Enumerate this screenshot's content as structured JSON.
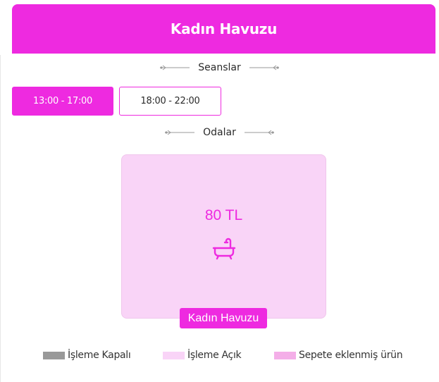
{
  "header": {
    "title": "Kadın Havuzu"
  },
  "sessions": {
    "heading": "Seanslar",
    "items": [
      {
        "label": "13:00 - 17:00",
        "active": true
      },
      {
        "label": "18:00 - 22:00",
        "active": false
      }
    ]
  },
  "rooms": {
    "heading": "Odalar",
    "items": [
      {
        "price": "80 TL",
        "name": "Kadın Havuzu",
        "icon": "bathtub-icon"
      }
    ]
  },
  "legend": {
    "items": [
      {
        "label": "İşleme Kapalı",
        "color": "#999999"
      },
      {
        "label": "İşleme Açık",
        "color": "#f9d4f7"
      },
      {
        "label": "Sepete eklenmiş ürün",
        "color": "#f4aee8"
      }
    ]
  },
  "colors": {
    "accent": "#ee2ae0",
    "card": "#f9d4f7"
  }
}
